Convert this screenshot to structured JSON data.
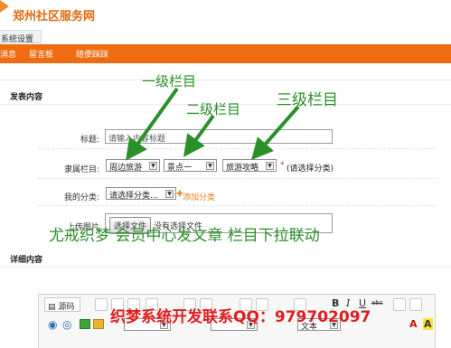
{
  "brand": {
    "title": "郑州社区服务网",
    "accent": "#ef6c12"
  },
  "system_tab": "系统设置",
  "nav": [
    "消息",
    "留言板",
    "随便踩踩"
  ],
  "section_publish": "发表内容",
  "form": {
    "title_label": "标题:",
    "title_value": "请输入内容标题",
    "category_label": "隶属栏目:",
    "level1": "周边旅游",
    "level2": "景点一",
    "level3": "旅游攻略",
    "required_hint": "(请选择分类)",
    "required_mark": "*",
    "my_category_label": "我的分类:",
    "my_category_value": "请选择分类...",
    "add_category_icon": "plus-icon",
    "add_category": "添加分类",
    "upload_label": "上传图片",
    "choose_file": "选择文件",
    "no_file": "没有选择文件"
  },
  "section_detail": "详细内容",
  "editor": {
    "source": "源码",
    "bold": "B",
    "italic": "I",
    "underline": "U",
    "strike": "abc",
    "font_size": "文本"
  },
  "annotations": {
    "level1": "一级栏目",
    "level2": "二级栏目",
    "level3": "三级栏目",
    "caption": "尤戒织梦 会员中心发文章 栏目下拉联动",
    "contact": "织梦系统开发联系QQ：979702097",
    "arrow_color": "#2b8f2a"
  }
}
